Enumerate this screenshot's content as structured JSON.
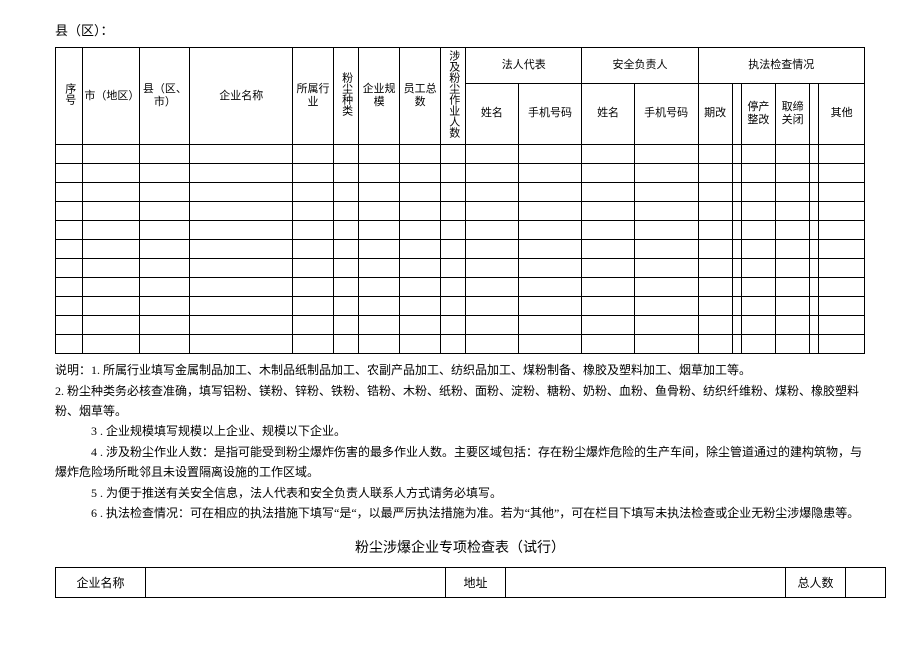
{
  "district_label": "县（区）：",
  "headers": {
    "seq": "序号",
    "city": "市（地区）",
    "county": "县（区、市）",
    "company": "企业名称",
    "industry": "所属行业",
    "dust_type": "粉尘种类",
    "scale": "企业规模",
    "employees": "员工总数",
    "dust_workers": "涉及粉尘作业人数",
    "legal_rep": "法人代表",
    "safety_officer": "安全负责人",
    "inspection": "执法检查情况",
    "name": "姓名",
    "phone": "手机号码",
    "deadline": "期改",
    "suspend": "停产整改",
    "ban": "取缔关闭",
    "other": "其他"
  },
  "notes": {
    "prefix": "说明：",
    "n1": "1. 所属行业填写金属制品加工、木制品纸制品加工、农副产品加工、纺织品加工、煤粉制备、橡胶及塑料加工、烟草加工等。",
    "n2": "2. 粉尘种类务必核查准确，填写铝粉、镁粉、锌粉、铁粉、锆粉、木粉、纸粉、面粉、淀粉、糖粉、奶粉、血粉、鱼骨粉、纺织纤维粉、煤粉、橡胶塑料粉、烟草等。",
    "n3": "3 . 企业规模填写规模以上企业、规模以下企业。",
    "n4": "4 . 涉及粉尘作业人数：是指可能受到粉尘爆炸伤害的最多作业人数。主要区域包括：存在粉尘爆炸危险的生产车间，除尘管道通过的建构筑物，与爆炸危险场所毗邻且未设置隔离设施的工作区域。",
    "n5": "5 . 为便于推送有关安全信息，法人代表和安全负责人联系人方式请务必填写。",
    "n6": "6 . 执法检查情况：可在相应的执法措施下填写“是“，以最严厉执法措施为准。若为“其他”，可在栏目下填写未执法检查或企业无粉尘涉爆隐患等。"
  },
  "bottom_title": "粉尘涉爆企业专项检查表（试行）",
  "bottom_headers": {
    "company": "企业名称",
    "address": "地址",
    "total": "总人数"
  }
}
